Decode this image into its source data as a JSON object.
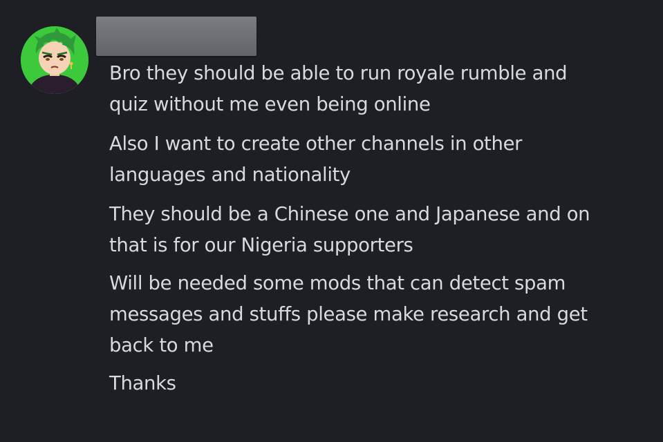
{
  "message": {
    "author": {
      "avatar_icon": "anime-character-green-hair-avatar",
      "avatar_bg_color": "#3cc93b",
      "name_redacted": true
    },
    "lines": [
      "Bro they should be able to run royale rumble and",
      "quiz without me even being online",
      "Also I want to create other channels in other",
      "languages and nationality",
      "They should be a Chinese one and Japanese and on",
      "that is for our Nigeria supporters",
      "Will be needed some mods that can detect spam",
      "messages and stuffs please make research and get",
      "back to me",
      "Thanks"
    ]
  },
  "colors": {
    "background": "#1e1f25",
    "text": "#d9dadd",
    "redaction": "#707277"
  }
}
